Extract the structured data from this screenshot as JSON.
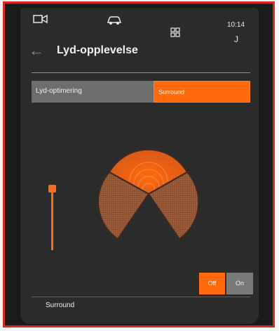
{
  "statusbar": {
    "time": "10:14",
    "user_initial": "J",
    "icons": [
      "camera-icon",
      "car-icon",
      "apps-grid-icon"
    ]
  },
  "header": {
    "back_icon": "arrow-left-icon",
    "title": "Lyd-opplevelse"
  },
  "sound_optimization": {
    "label": "Lyd-optimering",
    "selected_value": "Surround"
  },
  "surround": {
    "label": "Surround",
    "options": [
      "Off",
      "On"
    ],
    "selected": "Off"
  },
  "colors": {
    "accent": "#ff6a0c",
    "background": "#2b2b2b",
    "row": "#6d6d6d"
  }
}
